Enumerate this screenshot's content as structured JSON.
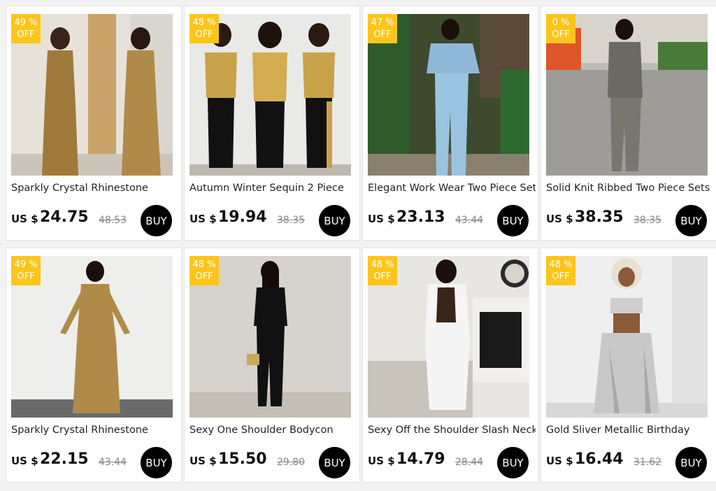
{
  "products": [
    {
      "discount_pct": "49 %",
      "discount_off": "OFF",
      "title": "Sparkly Crystal Rhinestone",
      "currency": "US $",
      "price": "24.75",
      "old_price": "48.53",
      "buy_label": "BUY"
    },
    {
      "discount_pct": "48 %",
      "discount_off": "OFF",
      "title": "Autumn Winter Sequin 2 Piece",
      "currency": "US $",
      "price": "19.94",
      "old_price": "38.35",
      "buy_label": "BUY"
    },
    {
      "discount_pct": "47 %",
      "discount_off": "OFF",
      "title": "Elegant Work Wear Two Piece Set",
      "currency": "US $",
      "price": "23.13",
      "old_price": "43.44",
      "buy_label": "BUY"
    },
    {
      "discount_pct": "0 %",
      "discount_off": "OFF",
      "title": "Solid Knit Ribbed Two Piece Sets",
      "currency": "US $",
      "price": "38.35",
      "old_price": "38.35",
      "buy_label": "BUY"
    },
    {
      "discount_pct": "49 %",
      "discount_off": "OFF",
      "title": "Sparkly Crystal Rhinestone",
      "currency": "US $",
      "price": "22.15",
      "old_price": "43.44",
      "buy_label": "BUY"
    },
    {
      "discount_pct": "48 %",
      "discount_off": "OFF",
      "title": "Sexy One Shoulder Bodycon",
      "currency": "US $",
      "price": "15.50",
      "old_price": "29.80",
      "buy_label": "BUY"
    },
    {
      "discount_pct": "48 %",
      "discount_off": "OFF",
      "title": "Sexy Off the Shoulder Slash Neck",
      "currency": "US $",
      "price": "14.79",
      "old_price": "28.44",
      "buy_label": "BUY"
    },
    {
      "discount_pct": "48 %",
      "discount_off": "OFF",
      "title": "Gold Sliver Metallic Birthday",
      "currency": "US $",
      "price": "16.44",
      "old_price": "31.62",
      "buy_label": "BUY"
    }
  ],
  "colors": {
    "badge": "#fdc51a",
    "buy_button": "#000000",
    "old_price": "#888888"
  }
}
